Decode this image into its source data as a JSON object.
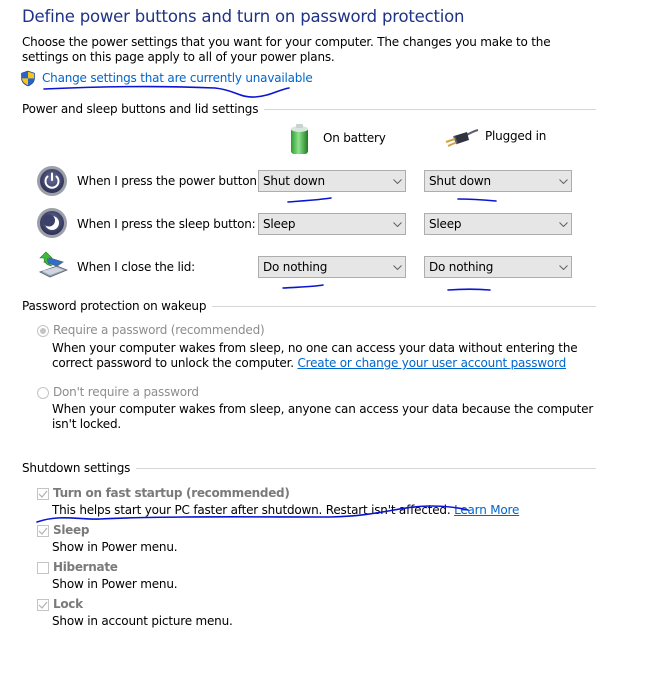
{
  "page": {
    "title": "Define power buttons and turn on password protection",
    "intro": "Choose the power settings that you want for your computer. The changes you make to the settings on this page apply to all of your power plans.",
    "change_settings_link": "Change settings that are currently unavailable",
    "shield_icon": "uac-shield-icon"
  },
  "power_section": {
    "heading": "Power and sleep buttons and lid settings",
    "columns": [
      {
        "label": "On battery",
        "icon": "battery-icon"
      },
      {
        "label": "Plugged in",
        "icon": "power-plug-icon"
      }
    ],
    "rows": [
      {
        "label": "When I press the power button:",
        "icon": "power-button-icon",
        "on_battery": "Shut down",
        "plugged_in": "Shut down"
      },
      {
        "label": "When I press the sleep button:",
        "icon": "sleep-button-icon",
        "on_battery": "Sleep",
        "plugged_in": "Sleep"
      },
      {
        "label": "When I close the lid:",
        "icon": "laptop-lid-icon",
        "on_battery": "Do nothing",
        "plugged_in": "Do nothing"
      }
    ]
  },
  "password_section": {
    "heading": "Password protection on wakeup",
    "options": [
      {
        "label": "Require a password (recommended)",
        "selected": true,
        "disabled": true,
        "description": "When your computer wakes from sleep, no one can access your data without entering the correct password to unlock the computer.",
        "link": "Create or change your user account password"
      },
      {
        "label": "Don't require a password",
        "selected": false,
        "disabled": true,
        "description": "When your computer wakes from sleep, anyone can access your data because the computer isn't locked."
      }
    ]
  },
  "shutdown_section": {
    "heading": "Shutdown settings",
    "items": [
      {
        "label": "Turn on fast startup (recommended)",
        "checked": true,
        "disabled": true,
        "description": "This helps start your PC faster after shutdown. Restart isn't affected.",
        "link": "Learn More"
      },
      {
        "label": "Sleep",
        "checked": true,
        "disabled": true,
        "description": "Show in Power menu."
      },
      {
        "label": "Hibernate",
        "checked": false,
        "disabled": true,
        "description": "Show in Power menu."
      },
      {
        "label": "Lock",
        "checked": true,
        "disabled": true,
        "description": "Show in account picture menu."
      }
    ]
  },
  "colors": {
    "title": "#1e3287",
    "link": "#0066cc",
    "annotation_ink": "#0a14d2",
    "disabled_text": "#8d8d8d",
    "dropdown_bg": "#e6e6e6"
  }
}
